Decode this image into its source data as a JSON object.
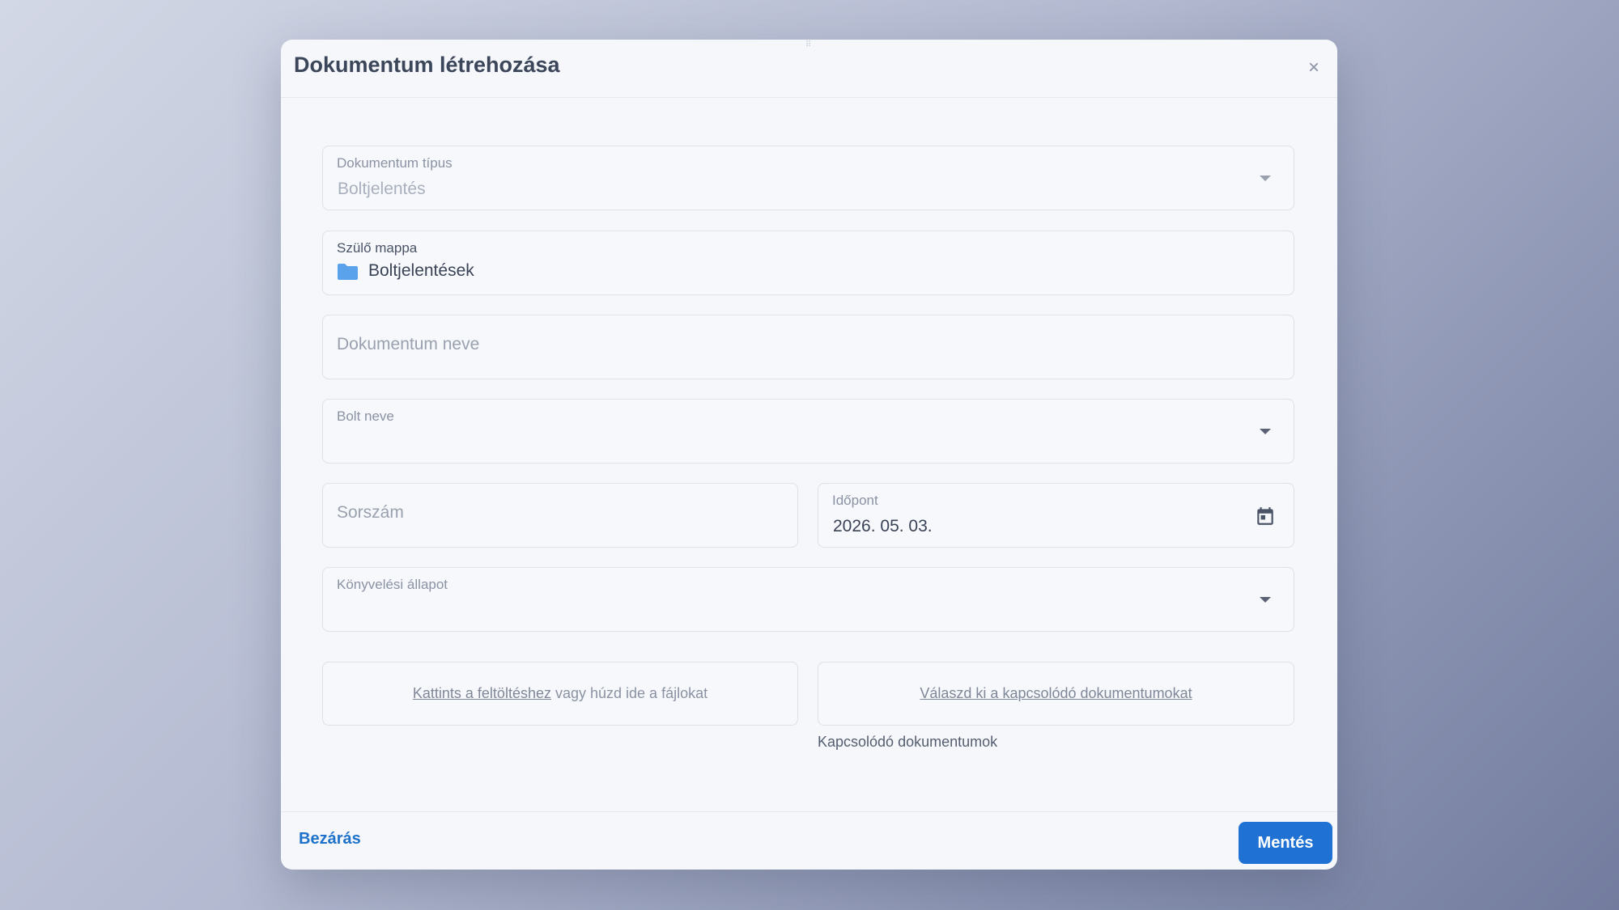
{
  "dialog": {
    "title": "Dokumentum létrehozása",
    "close_icon": "close-icon",
    "drag_icon": "drag-handle-icon"
  },
  "form": {
    "document_type": {
      "label": "Dokumentum típus",
      "value": "Boltjelentés"
    },
    "parent_folder": {
      "label": "Szülő mappa",
      "value": "Boltjelentések",
      "icon": "folder-icon",
      "icon_color": "#5aa3ec"
    },
    "document_name": {
      "placeholder": "Dokumentum neve"
    },
    "store_name": {
      "label": "Bolt neve",
      "value": ""
    },
    "serial_number": {
      "placeholder": "Sorszám"
    },
    "date": {
      "label": "Időpont",
      "value": "2026. 05. 03.",
      "icon": "calendar-icon"
    },
    "accounting_status": {
      "label": "Könyvelési állapot",
      "value": ""
    }
  },
  "upload": {
    "link_text": "Kattints a feltöltéshez",
    "rest_text": "vagy húzd ide a fájlokat"
  },
  "related": {
    "link_text": "Válaszd ki a kapcsolódó dokumentumokat",
    "caption": "Kapcsolódó dokumentumok"
  },
  "footer": {
    "close_label": "Bezárás",
    "save_label": "Mentés"
  },
  "colors": {
    "primary": "#1f72d3",
    "link": "#1f72c9"
  }
}
